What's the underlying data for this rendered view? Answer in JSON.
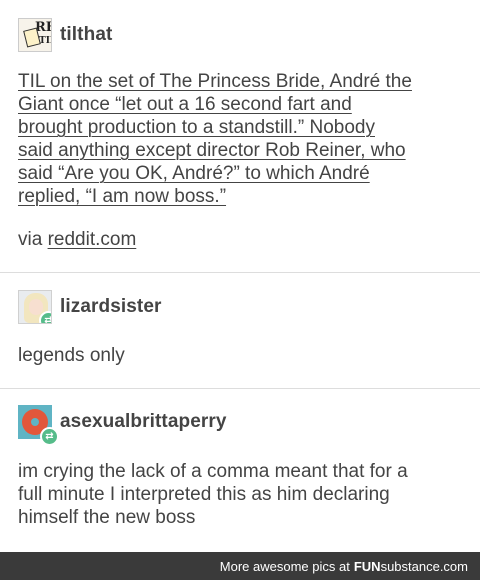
{
  "posts": [
    {
      "username": "tilthat",
      "avatar_text": "REI",
      "avatar_sub": "TIL",
      "lines": [
        "TIL on the set of The Princess Bride, André the",
        "Giant once “let out a 16 second fart and",
        "brought production to a standstill.” Nobody",
        "said anything except director Rob Reiner, who",
        "said “Are you OK, André?” to which André",
        "replied, “I am now boss.”"
      ],
      "via_label": "via",
      "via_link": "reddit.com"
    },
    {
      "username": "lizardsister",
      "lines": [
        "legends only"
      ]
    },
    {
      "username": "asexualbrittaperry",
      "lines": [
        "im crying the lack of a comma meant that for a",
        "full minute I interpreted this as him declaring",
        "himself the new boss"
      ]
    }
  ],
  "footer": {
    "prefix": "More awesome pics at",
    "brand_bold": "FUN",
    "brand_rest": "substance.com"
  },
  "colors": {
    "footer_bg": "#3a3a3a",
    "reblog_badge": "#56bc8a",
    "text": "#444444"
  }
}
